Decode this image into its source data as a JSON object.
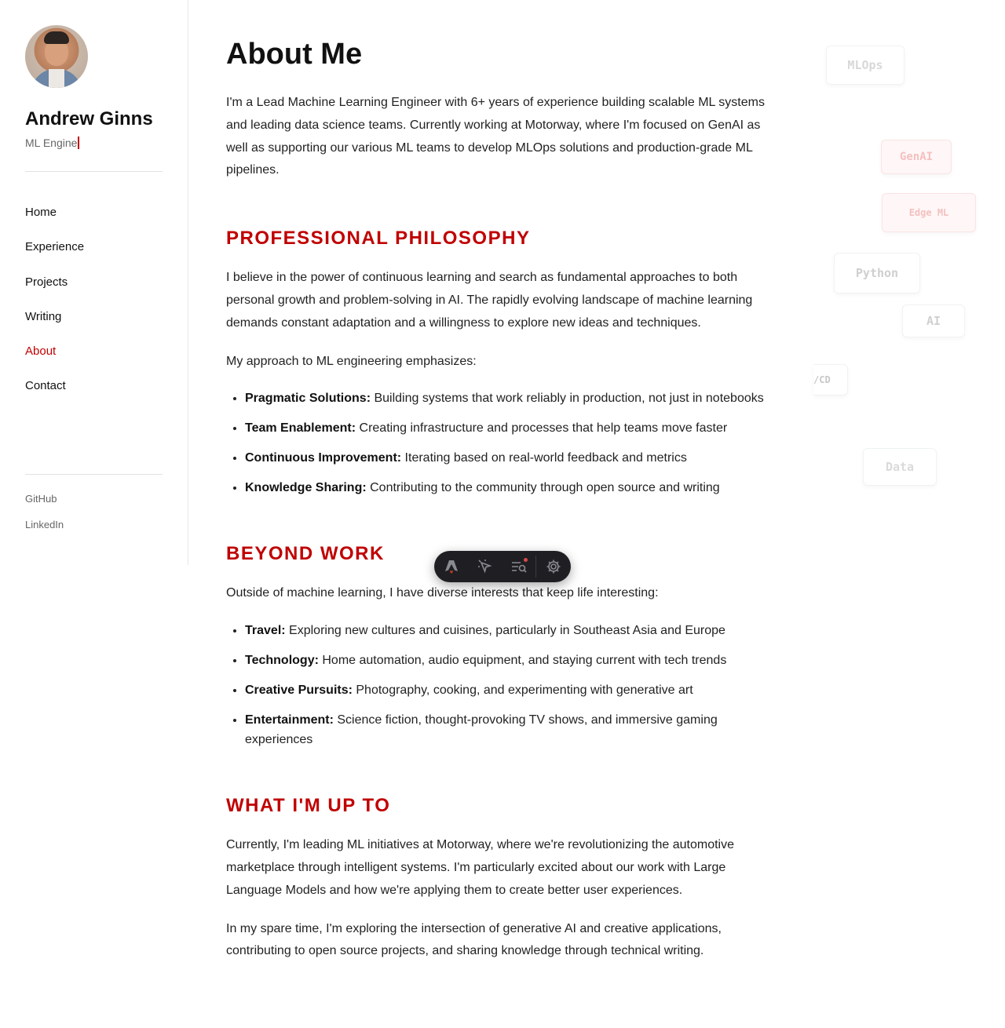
{
  "sidebar": {
    "name": "Andrew Ginns",
    "role_typed": "ML Engine",
    "nav": [
      "Home",
      "Experience",
      "Projects",
      "Writing",
      "About",
      "Contact"
    ],
    "active_nav": "About",
    "social": [
      "GitHub",
      "LinkedIn"
    ]
  },
  "main": {
    "title": "About Me",
    "intro": "I'm a Lead Machine Learning Engineer with 6+ years of experience building scalable ML systems and leading data science teams. Currently working at Motorway, where I'm focused on GenAI as well as supporting our various ML teams to develop MLOps solutions and production-grade ML pipelines.",
    "philosophy": {
      "heading": "PROFESSIONAL PHILOSOPHY",
      "p1": "I believe in the power of continuous learning and search as fundamental approaches to both personal growth and problem-solving in AI. The rapidly evolving landscape of machine learning demands constant adaptation and a willingness to explore new ideas and techniques.",
      "p2": "My approach to ML engineering emphasizes:",
      "items": [
        {
          "label": "Pragmatic Solutions:",
          "text": " Building systems that work reliably in production, not just in notebooks"
        },
        {
          "label": "Team Enablement:",
          "text": " Creating infrastructure and processes that help teams move faster"
        },
        {
          "label": "Continuous Improvement:",
          "text": " Iterating based on real-world feedback and metrics"
        },
        {
          "label": "Knowledge Sharing:",
          "text": " Contributing to the community through open source and writing"
        }
      ]
    },
    "beyond": {
      "heading": "BEYOND WORK",
      "p1": "Outside of machine learning, I have diverse interests that keep life interesting:",
      "items": [
        {
          "label": "Travel:",
          "text": " Exploring new cultures and cuisines, particularly in Southeast Asia and Europe"
        },
        {
          "label": "Technology:",
          "text": " Home automation, audio equipment, and staying current with tech trends"
        },
        {
          "label": "Creative Pursuits:",
          "text": " Photography, cooking, and experimenting with generative art"
        },
        {
          "label": "Entertainment:",
          "text": " Science fiction, thought-provoking TV shows, and immersive gaming experiences"
        }
      ]
    },
    "upto": {
      "heading": "WHAT I'M UP TO",
      "p1": "Currently, I'm leading ML initiatives at Motorway, where we're revolutionizing the automotive marketplace through intelligent systems. I'm particularly excited about our work with Large Language Models and how we're applying them to create better user experiences.",
      "p2": "In my spare time, I'm exploring the intersection of generative AI and creative applications, contributing to open source projects, and sharing knowledge through technical writing."
    }
  },
  "floating_tags": [
    "MLOps",
    "GenAI",
    "Edge ML",
    "Python",
    "AI",
    "/CD",
    "Data"
  ],
  "toolbar": {
    "icons": [
      "astro-logo-icon",
      "inspect-cursor-icon",
      "audit-list-icon",
      "settings-gear-icon"
    ],
    "notification_dot_color": "#d84a4a"
  },
  "colors": {
    "accent": "#c00000",
    "text": "#111111",
    "muted": "#666666"
  }
}
